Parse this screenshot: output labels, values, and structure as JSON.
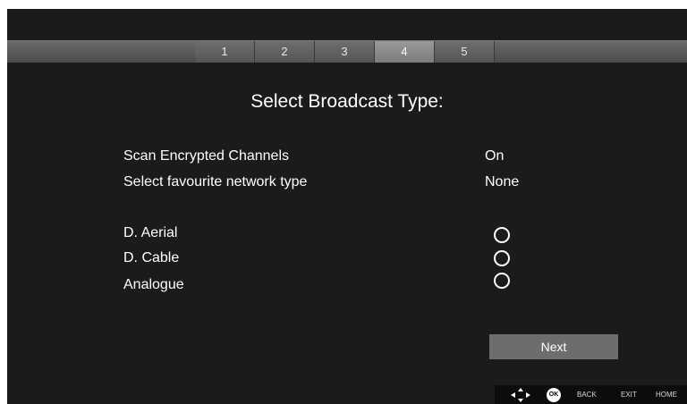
{
  "steps": {
    "items": [
      "1",
      "2",
      "3",
      "4",
      "5"
    ],
    "active_index": 3
  },
  "title": "Select Broadcast Type:",
  "settings": [
    {
      "label": "Scan Encrypted Channels",
      "value": "On"
    },
    {
      "label": "Select favourite network type",
      "value": "None"
    }
  ],
  "broadcast_types": [
    {
      "label": "D. Aerial",
      "selected": false
    },
    {
      "label": "D. Cable",
      "selected": false
    },
    {
      "label": "Analogue",
      "selected": false
    }
  ],
  "next_label": "Next",
  "hints": {
    "dpad_icon": "dpad-icon",
    "ok": "OK",
    "back": "BACK",
    "exit": "EXIT",
    "home": "HOME"
  },
  "colors": {
    "background": "#1b1b1b",
    "button": "#6d6d6d",
    "active_step": "#8a8a8a",
    "text": "#ffffff"
  }
}
